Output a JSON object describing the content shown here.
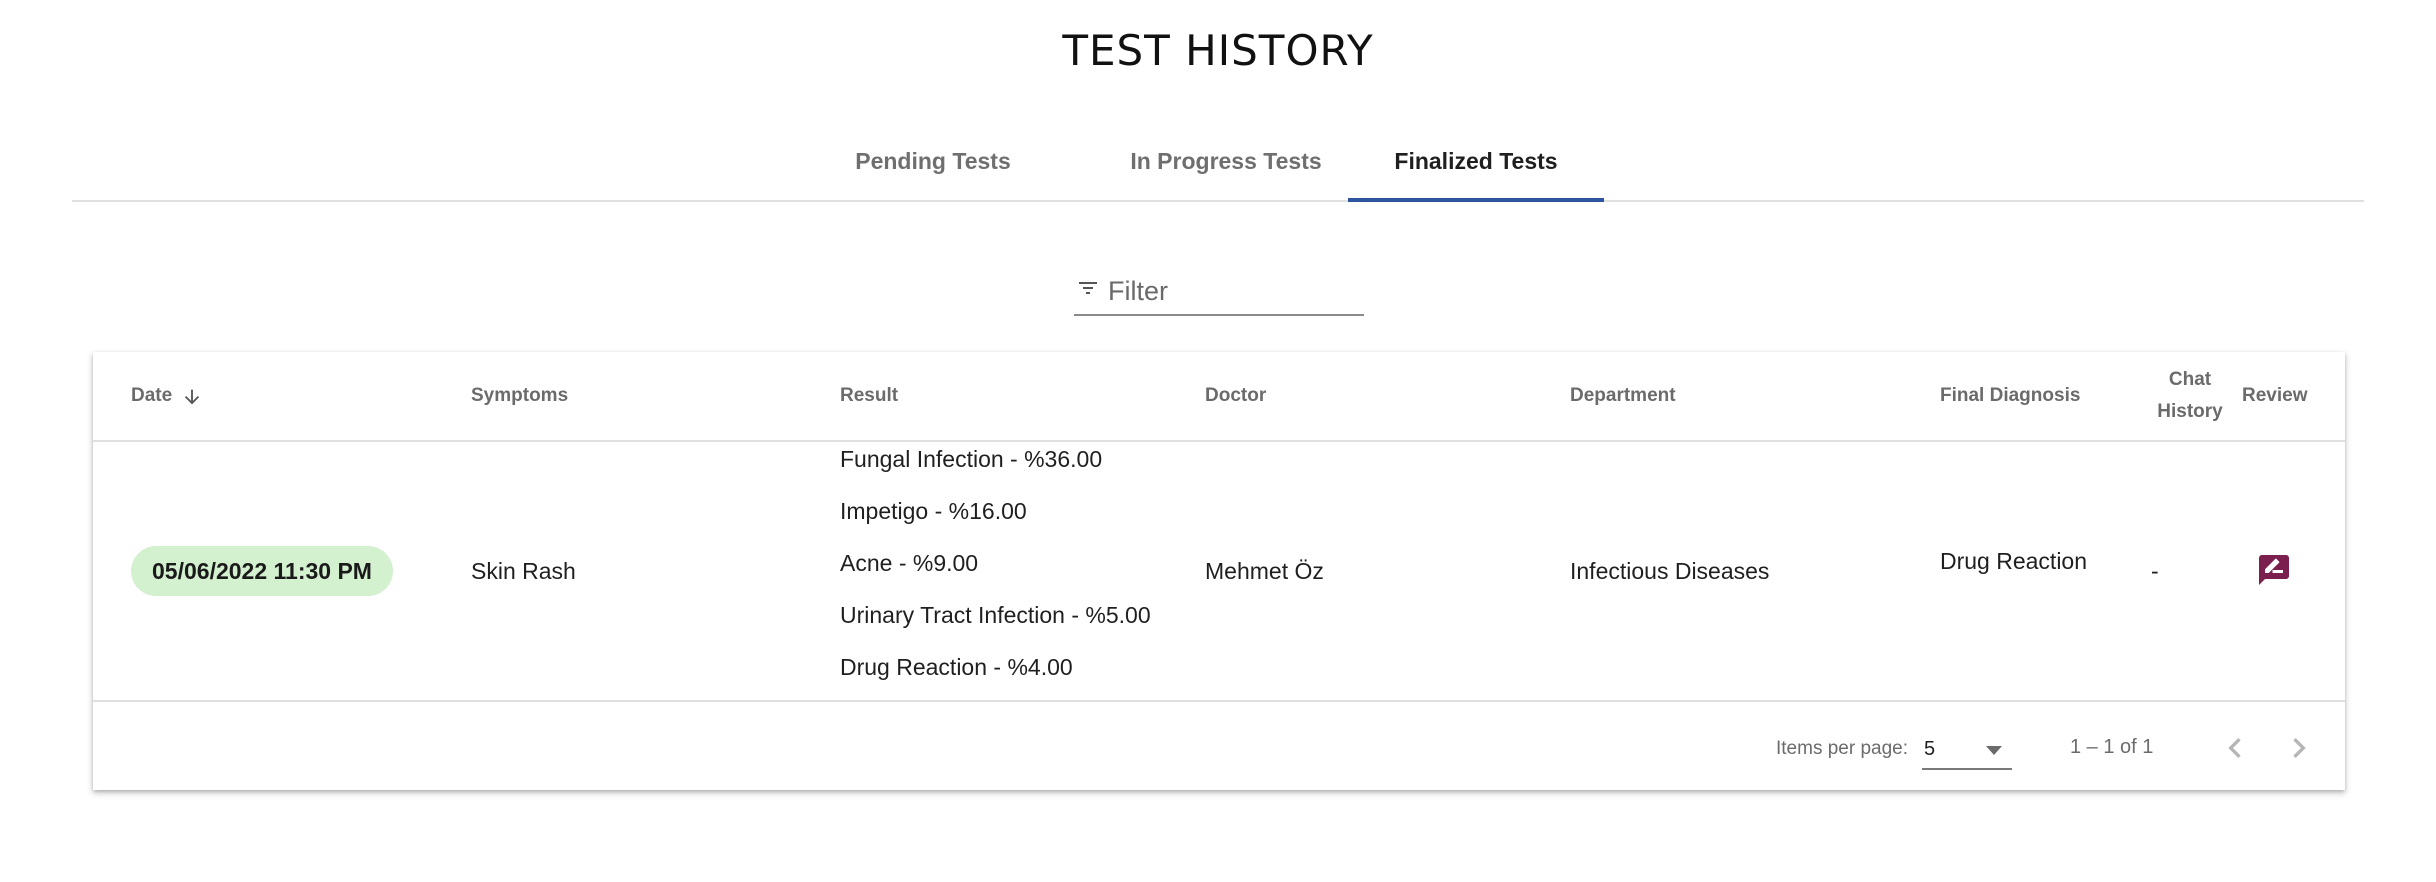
{
  "page": {
    "title": "TEST HISTORY"
  },
  "tabs": [
    {
      "label": "Pending Tests",
      "active": false
    },
    {
      "label": "In Progress Tests",
      "active": false
    },
    {
      "label": "Finalized Tests",
      "active": true
    }
  ],
  "filter": {
    "placeholder": "Filter",
    "value": "",
    "icon": "filter-icon"
  },
  "table": {
    "columns": {
      "date": "Date",
      "symptoms": "Symptoms",
      "result": "Result",
      "doctor": "Doctor",
      "department": "Department",
      "final_diagnosis": "Final Diagnosis",
      "chat_history_line1": "Chat",
      "chat_history_line2": "History",
      "review": "Review"
    },
    "sort": {
      "column": "date",
      "direction": "desc",
      "icon": "arrow-down-icon"
    },
    "rows": [
      {
        "date": "05/06/2022 11:30 PM",
        "symptoms": "Skin Rash",
        "results": [
          "Fungal Infection - %36.00",
          "Impetigo - %16.00",
          "Acne - %9.00",
          "Urinary Tract Infection - %5.00",
          "Drug Reaction - %4.00"
        ],
        "doctor": "Mehmet Öz",
        "department": "Infectious Diseases",
        "final_diagnosis": "Drug Reaction",
        "chat_history": "-",
        "review_icon": "rate-review-icon"
      }
    ]
  },
  "paginator": {
    "items_per_page_label": "Items per page:",
    "items_per_page": "5",
    "range": "1 – 1 of 1",
    "prev_icon": "chevron-left-icon",
    "next_icon": "chevron-right-icon"
  },
  "colors": {
    "accent": "#2d55a0",
    "date_chip_bg": "#d3f0cf",
    "review_icon": "#7b1f4e"
  }
}
